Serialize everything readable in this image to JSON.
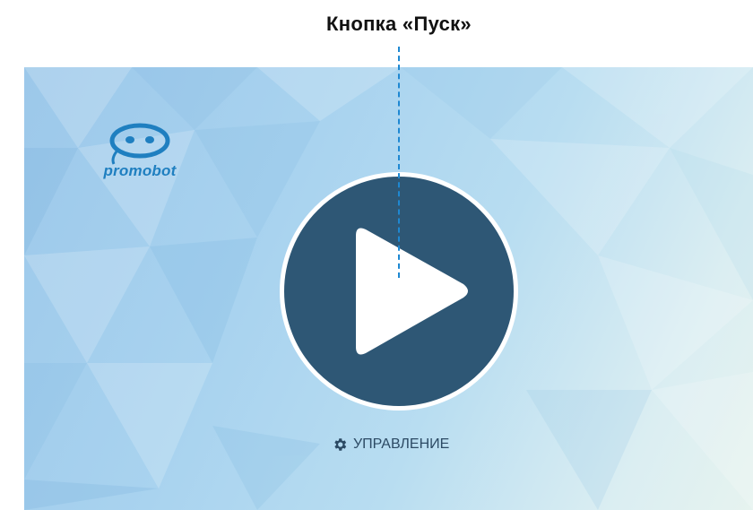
{
  "callout": {
    "title": "Кнопка «Пуск»"
  },
  "screen": {
    "logo": {
      "text": "promobot",
      "icon": "robot-face-icon"
    },
    "play_button": {
      "icon": "play-icon"
    },
    "control": {
      "icon": "gear-icon",
      "label": "УПРАВЛЕНИЕ"
    }
  },
  "colors": {
    "play_button_fill": "#2e5775",
    "logo_blue": "#1f7fc0",
    "callout_line": "#1e88d2"
  }
}
